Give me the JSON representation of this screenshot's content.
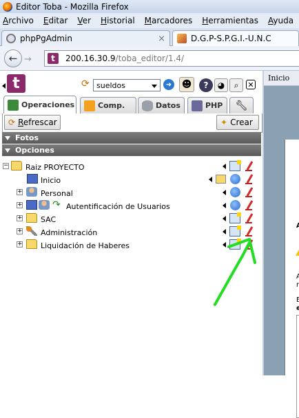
{
  "window": {
    "title": "Editor Toba - Mozilla Firefox"
  },
  "menubar": [
    "Archivo",
    "Editar",
    "Ver",
    "Historial",
    "Marcadores",
    "Herramientas",
    "Ayuda"
  ],
  "browser_tabs": [
    {
      "label": "phpPgAdmin",
      "close": "×"
    },
    {
      "label": "D.G.P-S.P.G.I.-U.N.C"
    }
  ],
  "navbar": {
    "url_host": "200.16.30.9",
    "url_path": "/toba_editor/1.4/"
  },
  "toba": {
    "project": "sueldos",
    "section_tabs": [
      "Operaciones",
      "Comp.",
      "Datos",
      "PHP"
    ],
    "refresh_label": "Refrescar",
    "create_label": "Crear",
    "sections": [
      "Fotos",
      "Opciones"
    ],
    "tree": [
      {
        "label": "Raiz PROYECTO",
        "expander": "−"
      },
      {
        "label": "Inicio"
      },
      {
        "label": "Personal",
        "expander": "+"
      },
      {
        "label": "Autentificación de Usuarios",
        "expander": "+"
      },
      {
        "label": "SAC",
        "expander": "+"
      },
      {
        "label": "Administración",
        "expander": "+"
      },
      {
        "label": "Liquidación de Haberes",
        "expander": "+"
      }
    ]
  },
  "right_pane": {
    "top_label": "Inicio",
    "letters": [
      "A",
      "A",
      "n",
      "E",
      "e"
    ]
  },
  "colors": {
    "annotation": "#22dd22",
    "toba_brand": "#8a2a6a"
  }
}
